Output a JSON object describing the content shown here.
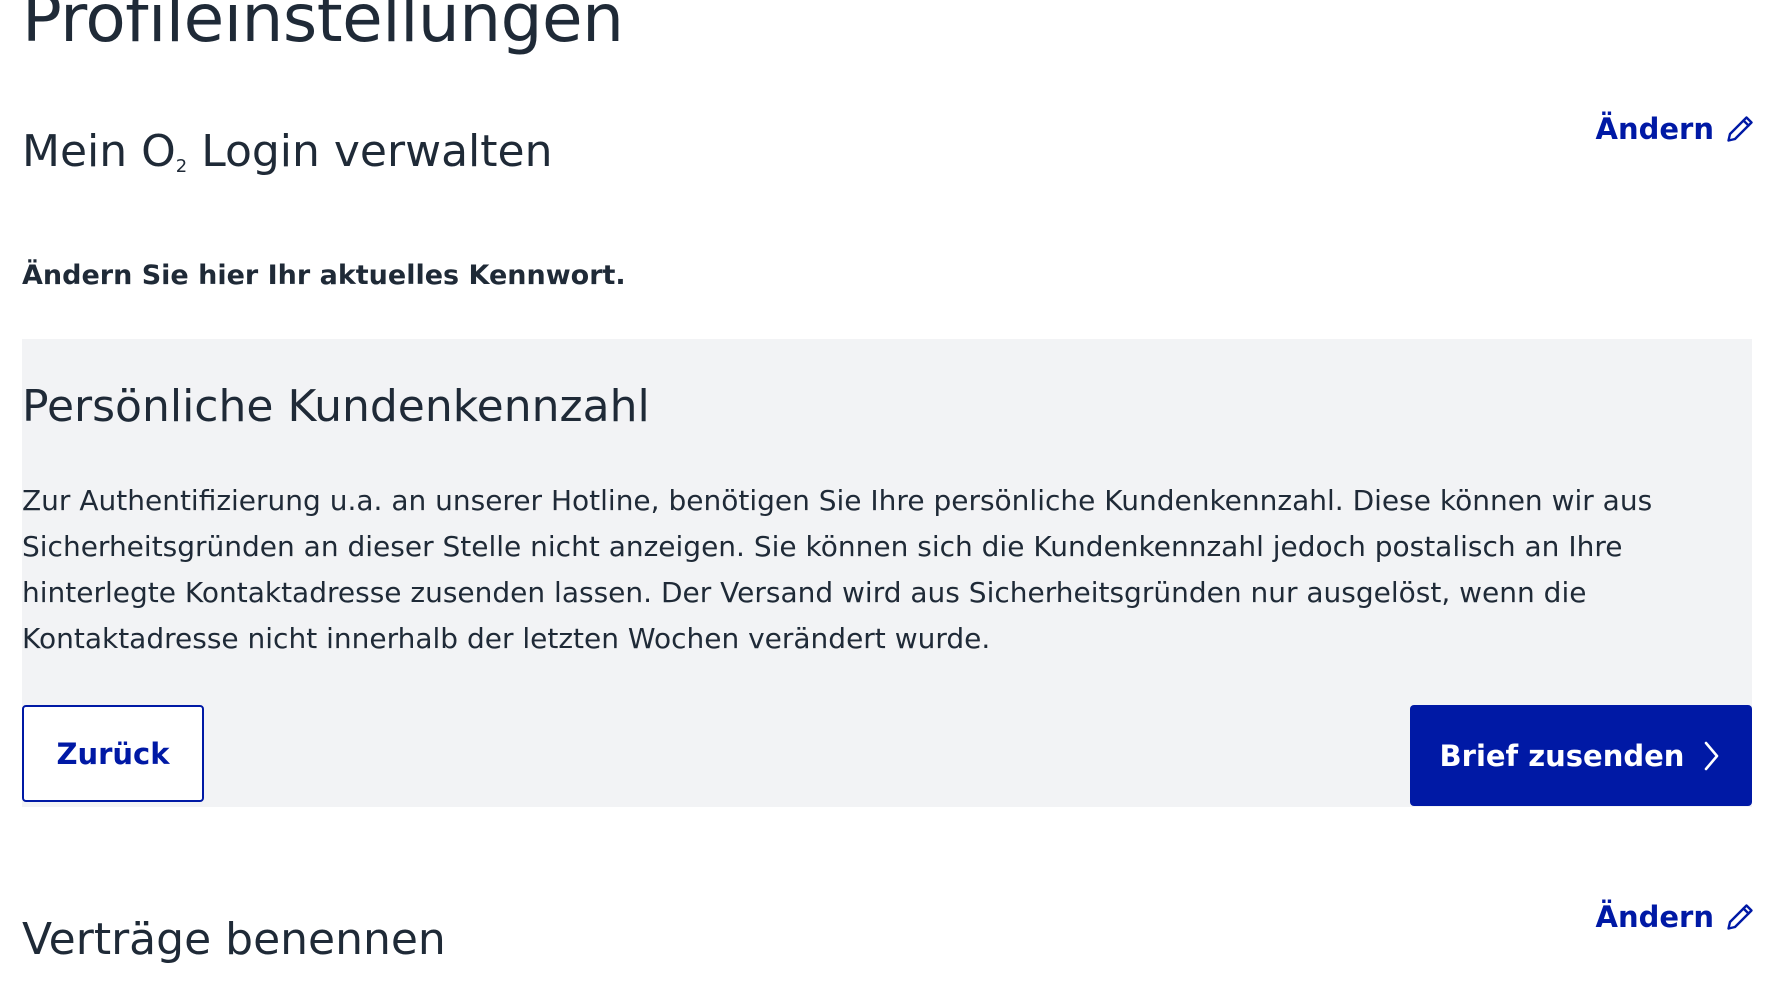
{
  "page": {
    "title": "Profileinstellungen"
  },
  "login_section": {
    "title_before": "Mein O",
    "title_subscript": "2",
    "title_after": " Login verwalten",
    "edit_label": "Ändern",
    "edit_icon": "pencil-icon",
    "notice": "Ändern Sie hier Ihr aktuelles Kennwort."
  },
  "kundenkennzahl": {
    "title": "Persönliche Kundenkennzahl",
    "text": "Zur Authentifizierung u.a. an unserer Hotline, benötigen Sie Ihre persönliche Kundenkennzahl. Diese können wir aus Sicherheitsgründen an dieser Stelle nicht anzeigen. Sie können sich die Kundenkennzahl jedoch postalisch an Ihre hinterlegte Kontaktadresse zusenden lassen. Der Versand wird aus Sicherheitsgründen nur ausgelöst, wenn die Kontaktadresse nicht innerhalb der letzten Wochen verändert wurde.",
    "back_label": "Zurück",
    "send_label": "Brief zusenden",
    "send_icon": "chevron-right-icon",
    "panel_bg": "#f2f3f5"
  },
  "contracts_section": {
    "title": "Verträge benennen",
    "edit_label": "Ändern",
    "edit_icon": "pencil-icon"
  },
  "colors": {
    "brand": "#0019a5",
    "text": "#1f2a37",
    "background": "#ffffff"
  }
}
